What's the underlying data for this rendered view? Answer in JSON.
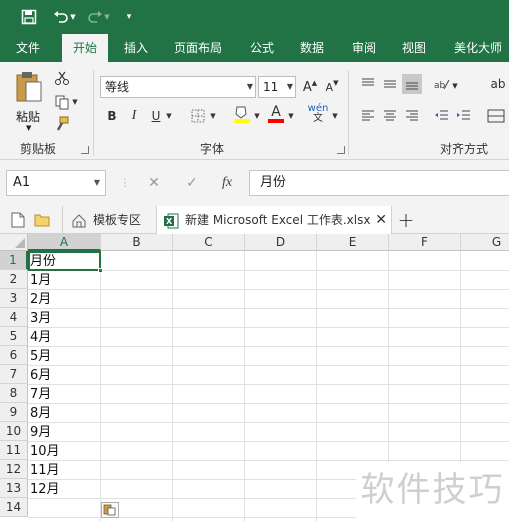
{
  "qat": {
    "save_icon": "save-icon",
    "undo_icon": "undo-icon",
    "redo_icon": "redo-icon",
    "customize_icon": "customize-qat-icon"
  },
  "tabs": [
    {
      "label": "文件"
    },
    {
      "label": "开始"
    },
    {
      "label": "插入"
    },
    {
      "label": "页面布局"
    },
    {
      "label": "公式"
    },
    {
      "label": "数据"
    },
    {
      "label": "审阅"
    },
    {
      "label": "视图"
    },
    {
      "label": "美化大师"
    }
  ],
  "ribbon": {
    "clipboard": {
      "paste_label": "粘贴",
      "group_label": "剪贴板"
    },
    "font": {
      "font_name": "等线",
      "font_size": "11",
      "bold": "B",
      "italic": "I",
      "underline": "U",
      "font_color_glyph": "A",
      "phonetic_glyph": "wén",
      "grow_glyph": "A",
      "shrink_glyph": "A",
      "group_label": "字体"
    },
    "alignment": {
      "wrap_glyph": "ab",
      "group_label": "对齐方式"
    },
    "accent_color": "#217346",
    "fill_color": "#ffff00",
    "font_color": "#ff0000"
  },
  "formula_bar": {
    "name_box": "A1",
    "cancel_glyph": "✕",
    "enter_glyph": "✓",
    "fx_glyph": "fx",
    "content": "月份"
  },
  "doc_tabs": [
    {
      "label": "模板专区"
    },
    {
      "label": "新建 Microsoft Excel 工作表.xlsx"
    }
  ],
  "sheet": {
    "columns": [
      "A",
      "B",
      "C",
      "D",
      "E",
      "F",
      "G"
    ],
    "rows": [
      "1",
      "2",
      "3",
      "4",
      "5",
      "6",
      "7",
      "8",
      "9",
      "10",
      "11",
      "12",
      "13",
      "14"
    ],
    "cells_a": [
      "月份",
      "1月",
      "2月",
      "3月",
      "4月",
      "5月",
      "6月",
      "7月",
      "8月",
      "9月",
      "10月",
      "11月",
      "12月",
      ""
    ],
    "selected_cell": "A1"
  },
  "watermark": "软件技巧"
}
